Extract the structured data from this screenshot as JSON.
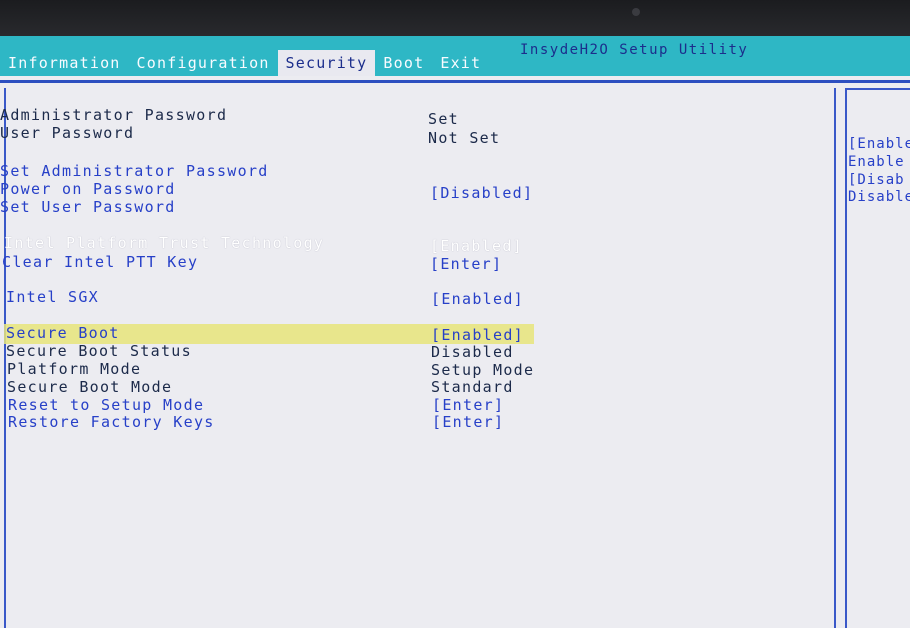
{
  "app_title": "InsydeH2O Setup Utility",
  "tabs": [
    {
      "label": "Information"
    },
    {
      "label": "Configuration"
    },
    {
      "label": "Security"
    },
    {
      "label": "Boot"
    },
    {
      "label": "Exit"
    }
  ],
  "active_tab": "Security",
  "rows": {
    "admin_password": {
      "label": "Administrator Password",
      "value": "Set"
    },
    "user_password": {
      "label": "User Password",
      "value": "Not Set"
    },
    "set_admin_password": {
      "label": "Set Administrator Password"
    },
    "power_on_password": {
      "label": "Power on Password",
      "value": "[Disabled]"
    },
    "set_user_password": {
      "label": "Set User Password"
    },
    "intel_ptt": {
      "label": "Intel Platform Trust Technology",
      "value": "[Enabled]"
    },
    "clear_ptt_key": {
      "label": "Clear Intel PTT Key",
      "value": "[Enter]"
    },
    "intel_sgx": {
      "label": "Intel SGX",
      "value": "[Enabled]"
    },
    "secure_boot": {
      "label": "Secure Boot",
      "value": "[Enabled]"
    },
    "secure_boot_status": {
      "label": "Secure Boot Status",
      "value": "Disabled"
    },
    "platform_mode": {
      "label": "Platform Mode",
      "value": "Setup Mode"
    },
    "secure_boot_mode": {
      "label": "Secure Boot Mode",
      "value": "Standard"
    },
    "reset_setup_mode": {
      "label": "Reset to Setup Mode",
      "value": "[Enter]"
    },
    "restore_factory_keys": {
      "label": "Restore Factory Keys",
      "value": "[Enter]"
    }
  },
  "help_panel": [
    "[Enable",
    "Enable",
    "[Disab",
    "Disable"
  ],
  "colors": {
    "header": "#2eb7c5",
    "selection_text": "#2740c8",
    "highlight": "#e8e57a",
    "background": "#ececf1"
  }
}
